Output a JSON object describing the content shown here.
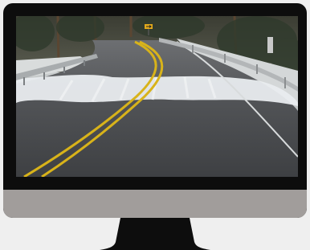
{
  "colors": {
    "page_background": "#efefef",
    "monitor_frame": "#0d0d0d",
    "monitor_chin": "#a19d9b",
    "stand": "#0d0d0d",
    "road_asphalt": "#47494c",
    "center_line": "#d8b31a",
    "snow": "#e9ecef",
    "sign": "#e0a81c"
  },
  "screen": {
    "scene": "snowy-curved-road",
    "road_sign_icon": "arrow-sign-icon"
  }
}
